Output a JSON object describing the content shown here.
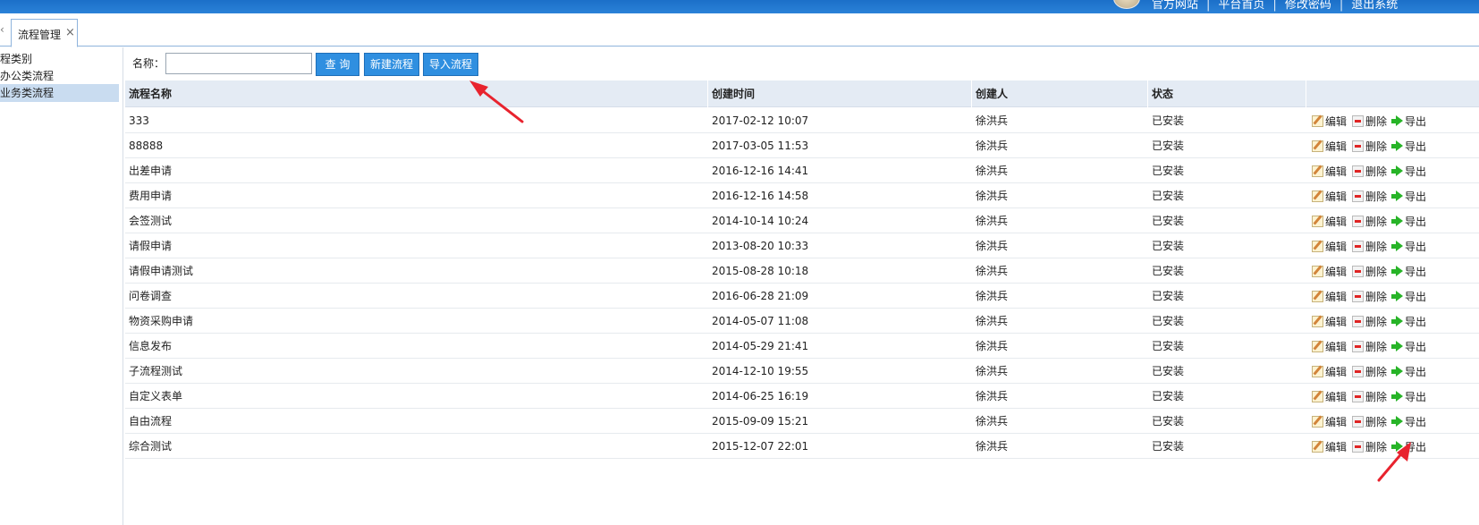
{
  "header": {
    "links": [
      "官方网站",
      "平台首页",
      "修改密码",
      "退出系统"
    ]
  },
  "tabs": [
    {
      "label": "流程管理"
    }
  ],
  "sidebar": {
    "items": [
      {
        "label": "程类别"
      },
      {
        "label": "办公类流程"
      },
      {
        "label": "业务类流程"
      }
    ]
  },
  "toolbar": {
    "name_label": "名称：",
    "name_value": "",
    "query_label": "查 询",
    "new_label": "新建流程",
    "import_label": "导入流程"
  },
  "table": {
    "columns": [
      "流程名称",
      "创建时间",
      "创建人",
      "状态"
    ],
    "actions": {
      "edit": "编辑",
      "delete": "删除",
      "export": "导出"
    },
    "rows": [
      {
        "name": "333",
        "time": "2017-02-12 10:07",
        "creator": "徐洪兵",
        "status": "已安装"
      },
      {
        "name": "88888",
        "time": "2017-03-05 11:53",
        "creator": "徐洪兵",
        "status": "已安装"
      },
      {
        "name": "出差申请",
        "time": "2016-12-16 14:41",
        "creator": "徐洪兵",
        "status": "已安装"
      },
      {
        "name": "费用申请",
        "time": "2016-12-16 14:58",
        "creator": "徐洪兵",
        "status": "已安装"
      },
      {
        "name": "会签测试",
        "time": "2014-10-14 10:24",
        "creator": "徐洪兵",
        "status": "已安装"
      },
      {
        "name": "请假申请",
        "time": "2013-08-20 10:33",
        "creator": "徐洪兵",
        "status": "已安装"
      },
      {
        "name": "请假申请测试",
        "time": "2015-08-28 10:18",
        "creator": "徐洪兵",
        "status": "已安装"
      },
      {
        "name": "问卷调查",
        "time": "2016-06-28 21:09",
        "creator": "徐洪兵",
        "status": "已安装"
      },
      {
        "name": "物资采购申请",
        "time": "2014-05-07 11:08",
        "creator": "徐洪兵",
        "status": "已安装"
      },
      {
        "name": "信息发布",
        "time": "2014-05-29 21:41",
        "creator": "徐洪兵",
        "status": "已安装"
      },
      {
        "name": "子流程测试",
        "time": "2014-12-10 19:55",
        "creator": "徐洪兵",
        "status": "已安装"
      },
      {
        "name": "自定义表单",
        "time": "2014-06-25 16:19",
        "creator": "徐洪兵",
        "status": "已安装"
      },
      {
        "name": "自由流程",
        "time": "2015-09-09 15:21",
        "creator": "徐洪兵",
        "status": "已安装"
      },
      {
        "name": "综合测试",
        "time": "2015-12-07 22:01",
        "creator": "徐洪兵",
        "status": "已安装"
      }
    ]
  },
  "colors": {
    "header_bg": "#1b6fc8",
    "button_bg": "#2f8fe0",
    "selected_item_bg": "#c9dcf0",
    "table_header_bg": "#e4ebf4",
    "annotation_arrow": "#e8232e"
  }
}
